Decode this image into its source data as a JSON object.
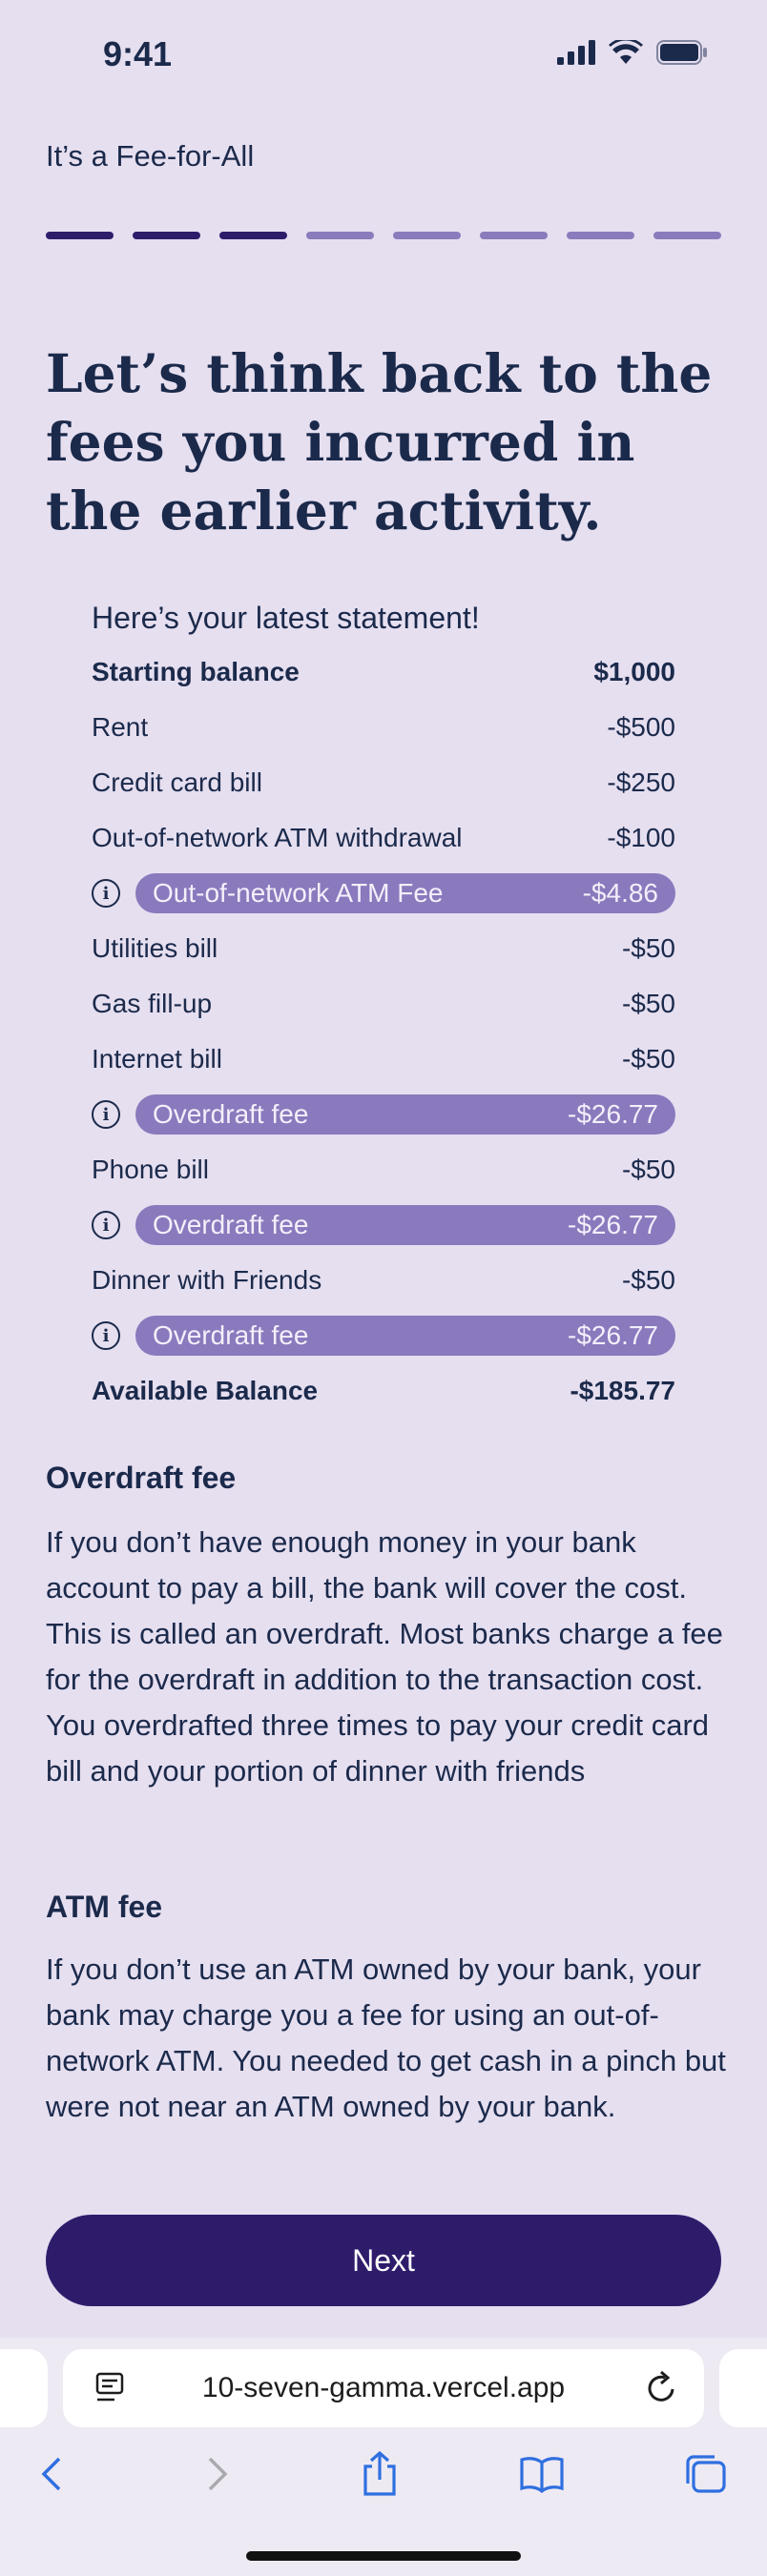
{
  "status": {
    "time": "9:41"
  },
  "app": {
    "title": "It’s a Fee-for-All"
  },
  "progress": {
    "total": 8,
    "completed": 3
  },
  "heading": "Let’s think back to the fees you incurred in the earlier activity.",
  "statement": {
    "title": "Here’s your latest statement!",
    "starting": {
      "label": "Starting balance",
      "amount": "$1,000"
    },
    "items": [
      {
        "label": "Rent",
        "amount": "-$500"
      },
      {
        "label": "Credit card bill",
        "amount": "-$250"
      },
      {
        "label": "Out-of-network ATM withdrawal",
        "amount": "-$100"
      },
      {
        "label": "Out-of-network ATM Fee",
        "amount": "-$4.86",
        "fee": true
      },
      {
        "label": "Utilities bill",
        "amount": "-$50"
      },
      {
        "label": "Gas fill-up",
        "amount": "-$50"
      },
      {
        "label": "Internet bill",
        "amount": "-$50"
      },
      {
        "label": "Overdraft fee",
        "amount": "-$26.77",
        "fee": true
      },
      {
        "label": "Phone bill",
        "amount": "-$50"
      },
      {
        "label": "Overdraft fee",
        "amount": "-$26.77",
        "fee": true
      },
      {
        "label": "Dinner with Friends",
        "amount": "-$50"
      },
      {
        "label": "Overdraft fee",
        "amount": "-$26.77",
        "fee": true
      }
    ],
    "available": {
      "label": "Available Balance",
      "amount": "-$185.77"
    }
  },
  "overdraft": {
    "title": "Overdraft fee",
    "body": "If you don’t have enough money in your bank account to pay a bill, the bank will cover the cost. This is called an overdraft. Most banks charge a fee for the overdraft in addition to the transaction cost. You overdrafted three times to pay your credit card bill and your portion of dinner with friends"
  },
  "atm": {
    "title": "ATM fee",
    "body": "If you don’t use an ATM owned by your bank, your bank may charge you a fee for using an out-of-network ATM.  You needed to get cash in a pinch but were not near an ATM owned by your bank."
  },
  "next_button": "Next",
  "browser": {
    "url": "10-seven-gamma.vercel.app"
  },
  "colors": {
    "accent": "#2e1c6b",
    "fee_pill": "#8a79bd",
    "background": "#e6dff0",
    "text": "#1b2a4b"
  }
}
